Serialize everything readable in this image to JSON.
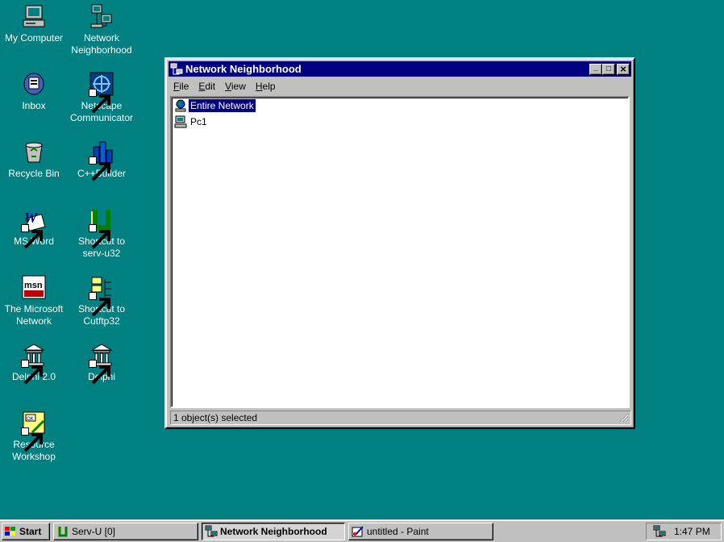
{
  "desktop": {
    "icons": [
      {
        "label": "My Computer",
        "icon": "my-computer-icon"
      },
      {
        "label": "Network Neighborhood",
        "icon": "network-neighborhood-icon"
      },
      {
        "label": "Inbox",
        "icon": "inbox-icon"
      },
      {
        "label": "Netscape Communicator",
        "icon": "netscape-icon"
      },
      {
        "label": "Recycle Bin",
        "icon": "recycle-bin-icon"
      },
      {
        "label": "C++Builder",
        "icon": "cppbuilder-icon"
      },
      {
        "label": "MS Word",
        "icon": "ms-word-icon"
      },
      {
        "label": "Shortcut to serv-u32",
        "icon": "servu-icon"
      },
      {
        "label": "The Microsoft Network",
        "icon": "msn-icon"
      },
      {
        "label": "Shortcut to Cutftp32",
        "icon": "cuteftp-icon"
      },
      {
        "label": "Delphi 2.0",
        "icon": "delphi-icon"
      },
      {
        "label": "Delphi",
        "icon": "delphi-icon"
      },
      {
        "label": "Resource Workshop",
        "icon": "resource-workshop-icon"
      }
    ]
  },
  "window": {
    "title": "Network Neighborhood",
    "buttons": {
      "minimize": "_",
      "maximize": "□",
      "close": "×"
    },
    "menu": [
      {
        "label": "File",
        "access": "F",
        "rest": "ile"
      },
      {
        "label": "Edit",
        "access": "E",
        "rest": "dit"
      },
      {
        "label": "View",
        "access": "V",
        "rest": "iew"
      },
      {
        "label": "Help",
        "access": "H",
        "rest": "elp"
      }
    ],
    "items": [
      {
        "label": "Entire Network",
        "icon": "globe-network-icon",
        "selected": true
      },
      {
        "label": "Pc1",
        "icon": "computer-icon",
        "selected": false
      }
    ],
    "status": "1 object(s) selected"
  },
  "taskbar": {
    "start_label": "Start",
    "tasks": [
      {
        "label": "Serv-U [0]",
        "icon": "servu-icon",
        "active": false
      },
      {
        "label": "Network Neighborhood",
        "icon": "network-neighborhood-icon",
        "active": true
      },
      {
        "label": "untitled - Paint",
        "icon": "paint-icon",
        "active": false
      }
    ],
    "clock": "1:47 PM",
    "tray_icon": "network-tray-icon"
  },
  "colors": {
    "desktop": "#008080",
    "title_bar": "#000080",
    "face": "#c0c0c0"
  }
}
